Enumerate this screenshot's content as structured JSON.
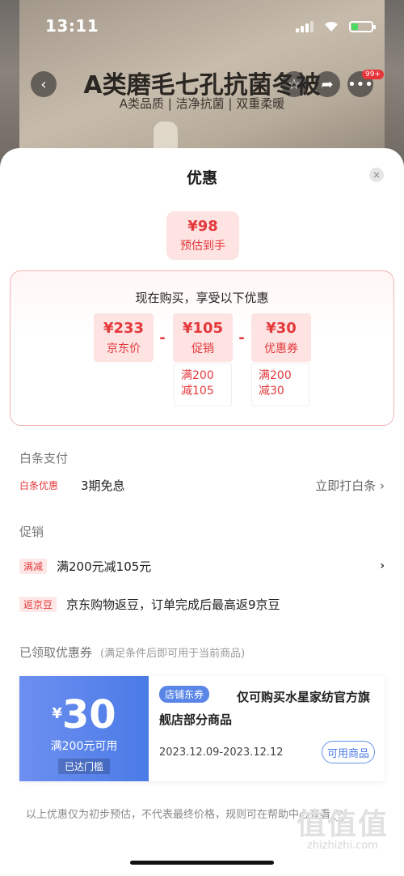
{
  "status_bar": {
    "time": "13:11"
  },
  "product": {
    "title": "A类磨毛七孔抗菌冬被",
    "subtitle": "A类品质 | 洁净抗菌 | 双重柔暖",
    "message_badge": "99+"
  },
  "sheet": {
    "title": "优惠",
    "close_icon": "×"
  },
  "final_price": {
    "price": "¥98",
    "label": "预估到手"
  },
  "breakdown": {
    "heading": "现在购买，享受以下优惠",
    "items": [
      {
        "value": "¥233",
        "name": "京东价"
      },
      {
        "value": "¥105",
        "name": "促销",
        "cond1": "满200",
        "cond2": "减105"
      },
      {
        "value": "¥30",
        "name": "优惠券",
        "cond1": "满200",
        "cond2": "减30"
      }
    ],
    "operator": "-"
  },
  "baitiao": {
    "section": "白条支付",
    "tag": "白条优惠",
    "text": "3期免息",
    "action": "立即打白条 ›"
  },
  "promotions": {
    "section": "促销",
    "items": [
      {
        "tag": "满减",
        "text": "满200元减105元",
        "chevron": "›"
      },
      {
        "tag": "返京豆",
        "text": "京东购物返豆，订单完成后最高返9京豆"
      }
    ]
  },
  "coupons": {
    "section": "已领取优惠券",
    "note": "(满足条件后即可用于当前商品)",
    "items": [
      {
        "currency": "¥",
        "amount": "30",
        "condition": "满200元可用",
        "status": "已达门槛",
        "kind": "店铺东券",
        "description": "仅可购买水星家纺官方旗舰店部分商品",
        "validity": "2023.12.09-2023.12.12",
        "button": "可用商品"
      }
    ]
  },
  "footer": {
    "note": "以上优惠仅为初步预估，不代表最终价格，规则可在帮助中心查看"
  },
  "watermark": {
    "big": "值值值",
    "small": "zhizhizhi.com"
  }
}
